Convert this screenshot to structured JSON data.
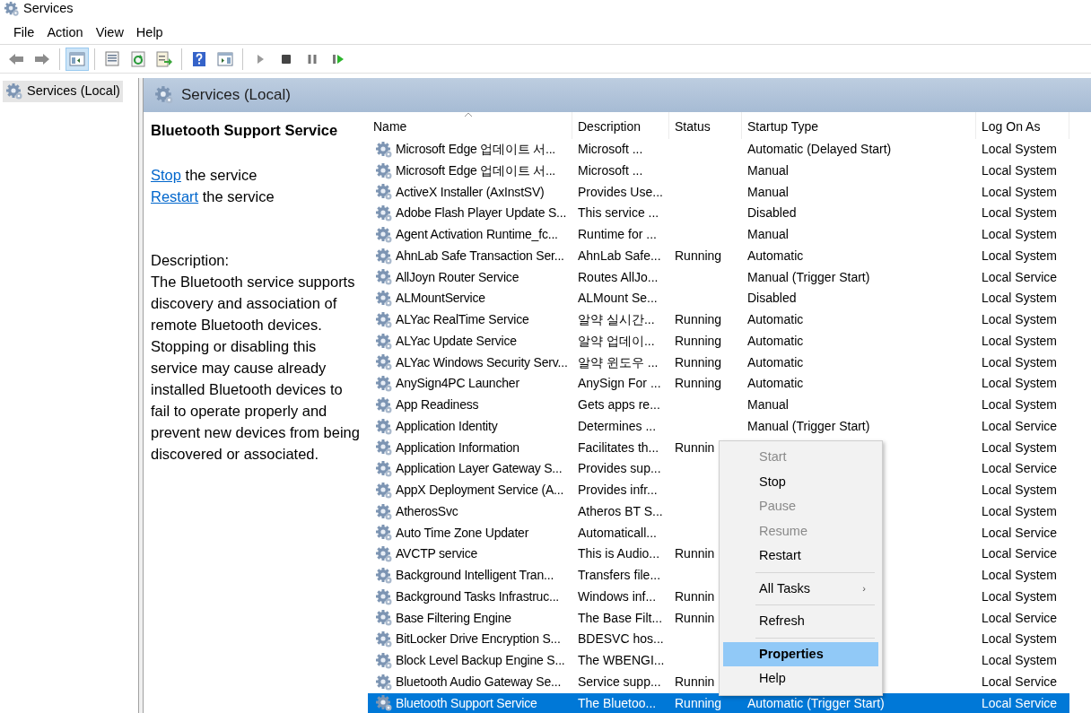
{
  "window": {
    "title": "Services"
  },
  "menu_bar": [
    "File",
    "Action",
    "View",
    "Help"
  ],
  "toolbar": [
    {
      "kind": "back",
      "pressed": false
    },
    {
      "kind": "forward",
      "pressed": false
    },
    {
      "kind": "sep"
    },
    {
      "kind": "tree",
      "pressed": true
    },
    {
      "kind": "sep"
    },
    {
      "kind": "properties",
      "pressed": false
    },
    {
      "kind": "refresh",
      "pressed": false
    },
    {
      "kind": "export",
      "pressed": false
    },
    {
      "kind": "sep"
    },
    {
      "kind": "help",
      "pressed": false
    },
    {
      "kind": "view",
      "pressed": false
    },
    {
      "kind": "sep"
    },
    {
      "kind": "start",
      "pressed": false
    },
    {
      "kind": "stop",
      "pressed": false
    },
    {
      "kind": "pause",
      "pressed": false
    },
    {
      "kind": "resume",
      "pressed": false
    }
  ],
  "tree": [
    {
      "label": "Services (Local)",
      "selected": true
    }
  ],
  "header": {
    "title": "Services (Local)"
  },
  "details": {
    "title": "Bluetooth Support Service",
    "actions": [
      {
        "link": "Stop",
        "text": "the service"
      },
      {
        "link": "Restart",
        "text": "the service"
      }
    ],
    "description_label": "Description:",
    "description": "The Bluetooth service supports discovery and association of remote Bluetooth devices.  Stopping or disabling this service may cause already installed Bluetooth devices to fail to operate properly and prevent new devices from being discovered or associated."
  },
  "table": {
    "columns": [
      {
        "label": "Name",
        "sorted": true
      },
      {
        "label": "Description",
        "sorted": false
      },
      {
        "label": "Status",
        "sorted": false
      },
      {
        "label": "Startup Type",
        "sorted": false
      },
      {
        "label": "Log On As",
        "sorted": false
      }
    ],
    "rows": [
      {
        "name": "Microsoft Edge 업데이트 서...",
        "description": "Microsoft ...",
        "status": "",
        "startup_type": "Automatic (Delayed Start)",
        "log_on_as": "Local System",
        "selected": false
      },
      {
        "name": "Microsoft Edge 업데이트 서...",
        "description": "Microsoft ...",
        "status": "",
        "startup_type": "Manual",
        "log_on_as": "Local System",
        "selected": false
      },
      {
        "name": "ActiveX Installer (AxInstSV)",
        "description": "Provides Use...",
        "status": "",
        "startup_type": "Manual",
        "log_on_as": "Local System",
        "selected": false
      },
      {
        "name": "Adobe Flash Player Update S...",
        "description": "This service ...",
        "status": "",
        "startup_type": "Disabled",
        "log_on_as": "Local System",
        "selected": false
      },
      {
        "name": "Agent Activation Runtime_fc...",
        "description": "Runtime for ...",
        "status": "",
        "startup_type": "Manual",
        "log_on_as": "Local System",
        "selected": false
      },
      {
        "name": "AhnLab Safe Transaction Ser...",
        "description": "AhnLab Safe...",
        "status": "Running",
        "startup_type": "Automatic",
        "log_on_as": "Local System",
        "selected": false
      },
      {
        "name": "AllJoyn Router Service",
        "description": "Routes AllJo...",
        "status": "",
        "startup_type": "Manual (Trigger Start)",
        "log_on_as": "Local Service",
        "selected": false
      },
      {
        "name": "ALMountService",
        "description": "ALMount Se...",
        "status": "",
        "startup_type": "Disabled",
        "log_on_as": "Local System",
        "selected": false
      },
      {
        "name": "ALYac RealTime Service",
        "description": "알약 실시간...",
        "status": "Running",
        "startup_type": "Automatic",
        "log_on_as": "Local System",
        "selected": false
      },
      {
        "name": "ALYac Update Service",
        "description": "알약 업데이...",
        "status": "Running",
        "startup_type": "Automatic",
        "log_on_as": "Local System",
        "selected": false
      },
      {
        "name": "ALYac Windows Security Serv...",
        "description": "알약 윈도우 ...",
        "status": "Running",
        "startup_type": "Automatic",
        "log_on_as": "Local System",
        "selected": false
      },
      {
        "name": "AnySign4PC Launcher",
        "description": "AnySign For ...",
        "status": "Running",
        "startup_type": "Automatic",
        "log_on_as": "Local System",
        "selected": false
      },
      {
        "name": "App Readiness",
        "description": "Gets apps re...",
        "status": "",
        "startup_type": "Manual",
        "log_on_as": "Local System",
        "selected": false
      },
      {
        "name": "Application Identity",
        "description": "Determines ...",
        "status": "",
        "startup_type": "Manual (Trigger Start)",
        "log_on_as": "Local Service",
        "selected": false
      },
      {
        "name": "Application Information",
        "description": "Facilitates th...",
        "status": "Runnin",
        "startup_type": "",
        "log_on_as": "Local System",
        "selected": false
      },
      {
        "name": "Application Layer Gateway S...",
        "description": "Provides sup...",
        "status": "",
        "startup_type": "",
        "log_on_as": "Local Service",
        "selected": false
      },
      {
        "name": "AppX Deployment Service (A...",
        "description": "Provides infr...",
        "status": "",
        "startup_type": "",
        "log_on_as": "Local System",
        "selected": false
      },
      {
        "name": "AtherosSvc",
        "description": "Atheros BT S...",
        "status": "",
        "startup_type": "",
        "log_on_as": "Local System",
        "selected": false
      },
      {
        "name": "Auto Time Zone Updater",
        "description": "Automaticall...",
        "status": "",
        "startup_type": "",
        "log_on_as": "Local Service",
        "selected": false
      },
      {
        "name": "AVCTP service",
        "description": "This is Audio...",
        "status": "Runnin",
        "startup_type": "",
        "log_on_as": "Local Service",
        "selected": false
      },
      {
        "name": "Background Intelligent Tran...",
        "description": "Transfers file...",
        "status": "",
        "startup_type": "",
        "log_on_as": "Local System",
        "selected": false
      },
      {
        "name": "Background Tasks Infrastruc...",
        "description": "Windows inf...",
        "status": "Runnin",
        "startup_type": "",
        "log_on_as": "Local System",
        "selected": false
      },
      {
        "name": "Base Filtering Engine",
        "description": "The Base Filt...",
        "status": "Runnin",
        "startup_type": "",
        "log_on_as": "Local Service",
        "selected": false
      },
      {
        "name": "BitLocker Drive Encryption S...",
        "description": "BDESVC hos...",
        "status": "",
        "startup_type": "",
        "log_on_as": "Local System",
        "selected": false
      },
      {
        "name": "Block Level Backup Engine S...",
        "description": "The WBENGI...",
        "status": "",
        "startup_type": "",
        "log_on_as": "Local System",
        "selected": false
      },
      {
        "name": "Bluetooth Audio Gateway Se...",
        "description": "Service supp...",
        "status": "Runnin",
        "startup_type": "",
        "log_on_as": "Local Service",
        "selected": false
      },
      {
        "name": "Bluetooth Support Service",
        "description": "The Bluetoo...",
        "status": "Running",
        "startup_type": "Automatic (Trigger Start)",
        "log_on_as": "Local Service",
        "selected": true
      }
    ]
  },
  "context_menu": {
    "items": [
      {
        "kind": "item",
        "label": "Start",
        "disabled": true,
        "selected": false
      },
      {
        "kind": "item",
        "label": "Stop",
        "disabled": false,
        "selected": false
      },
      {
        "kind": "item",
        "label": "Pause",
        "disabled": true,
        "selected": false
      },
      {
        "kind": "item",
        "label": "Resume",
        "disabled": true,
        "selected": false
      },
      {
        "kind": "item",
        "label": "Restart",
        "disabled": false,
        "selected": false
      },
      {
        "kind": "separator"
      },
      {
        "kind": "item",
        "label": "All Tasks",
        "disabled": false,
        "selected": false,
        "submenu_arrow": "›"
      },
      {
        "kind": "separator"
      },
      {
        "kind": "item",
        "label": "Refresh",
        "disabled": false,
        "selected": false
      },
      {
        "kind": "separator"
      },
      {
        "kind": "item",
        "label": "Properties",
        "disabled": false,
        "selected": true
      },
      {
        "kind": "item",
        "label": "Help",
        "disabled": false,
        "selected": false
      }
    ]
  }
}
